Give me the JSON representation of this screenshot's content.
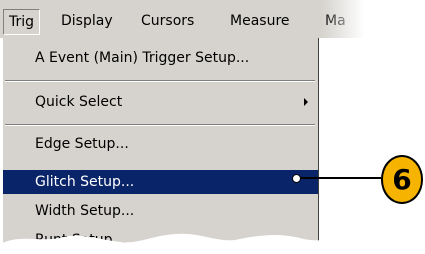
{
  "menubar": {
    "items": [
      "Trig",
      "Display",
      "Cursors",
      "Measure",
      "Ma"
    ]
  },
  "dropdown": {
    "items": [
      "A Event (Main) Trigger Setup...",
      "Quick Select",
      "Edge Setup...",
      "Glitch Setup...",
      "Width Setup...",
      "Runt Setup..."
    ],
    "selected_index": 3
  },
  "callout": {
    "label": "6"
  },
  "colors": {
    "menu_bg": "#d6d3ce",
    "highlight": "#0a246a",
    "callout_fill": "#f6b400"
  }
}
